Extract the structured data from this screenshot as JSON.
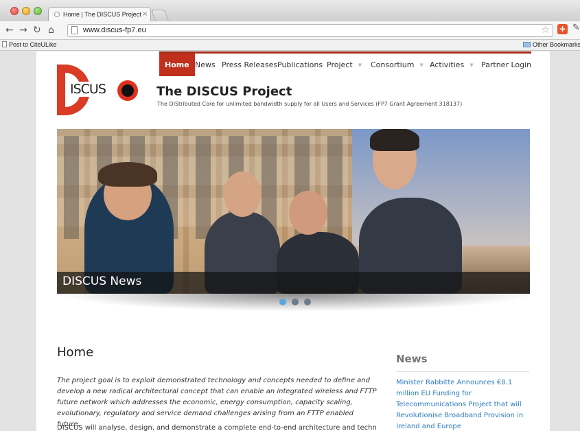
{
  "browser": {
    "tab_title": "Home | The DISCUS Project",
    "tab_close": "×",
    "url": "www.discus-fp7.eu",
    "bookmark_item": "Post to CiteULike",
    "other_bookmarks": "Other Bookmarks",
    "ext_label": "+"
  },
  "site": {
    "logo_text": "ISCUS",
    "title": "The DISCUS Project",
    "subtitle": "The DIStributed Core for unlimited bandwidth supply for all Users and Services (FP7 Grant Agreement 318137)",
    "nav": [
      {
        "label": "Home"
      },
      {
        "label": "News"
      },
      {
        "label": "Press Releases"
      },
      {
        "label": "Publications"
      },
      {
        "label": "Project"
      },
      {
        "label": "Consortium"
      },
      {
        "label": "Activities"
      },
      {
        "label": "Partner Login"
      }
    ],
    "caret": "▼",
    "slider_caption": "DISCUS News",
    "slider_dots_active": 1
  },
  "content": {
    "heading": "Home",
    "intro": "The project goal is to exploit demonstrated technology and concepts needed to define and develop a new radical architectural concept that can enable an integrated wireless and FTTP future network which addresses the economic, energy consumption, capacity scaling, evolutionary, regulatory and service demand challenges arising from an FTTP enabled future.",
    "intro2": "DISCUS will analyse, design, and demonstrate a complete end-to-end architecture and technologies"
  },
  "sidebar": {
    "news_heading": "News",
    "news_item": "Minister Rabbitte Announces €8.1 million EU Funding for Telecommunications Project that will Revolutionise Broadband Provision in Ireland and Europe"
  }
}
